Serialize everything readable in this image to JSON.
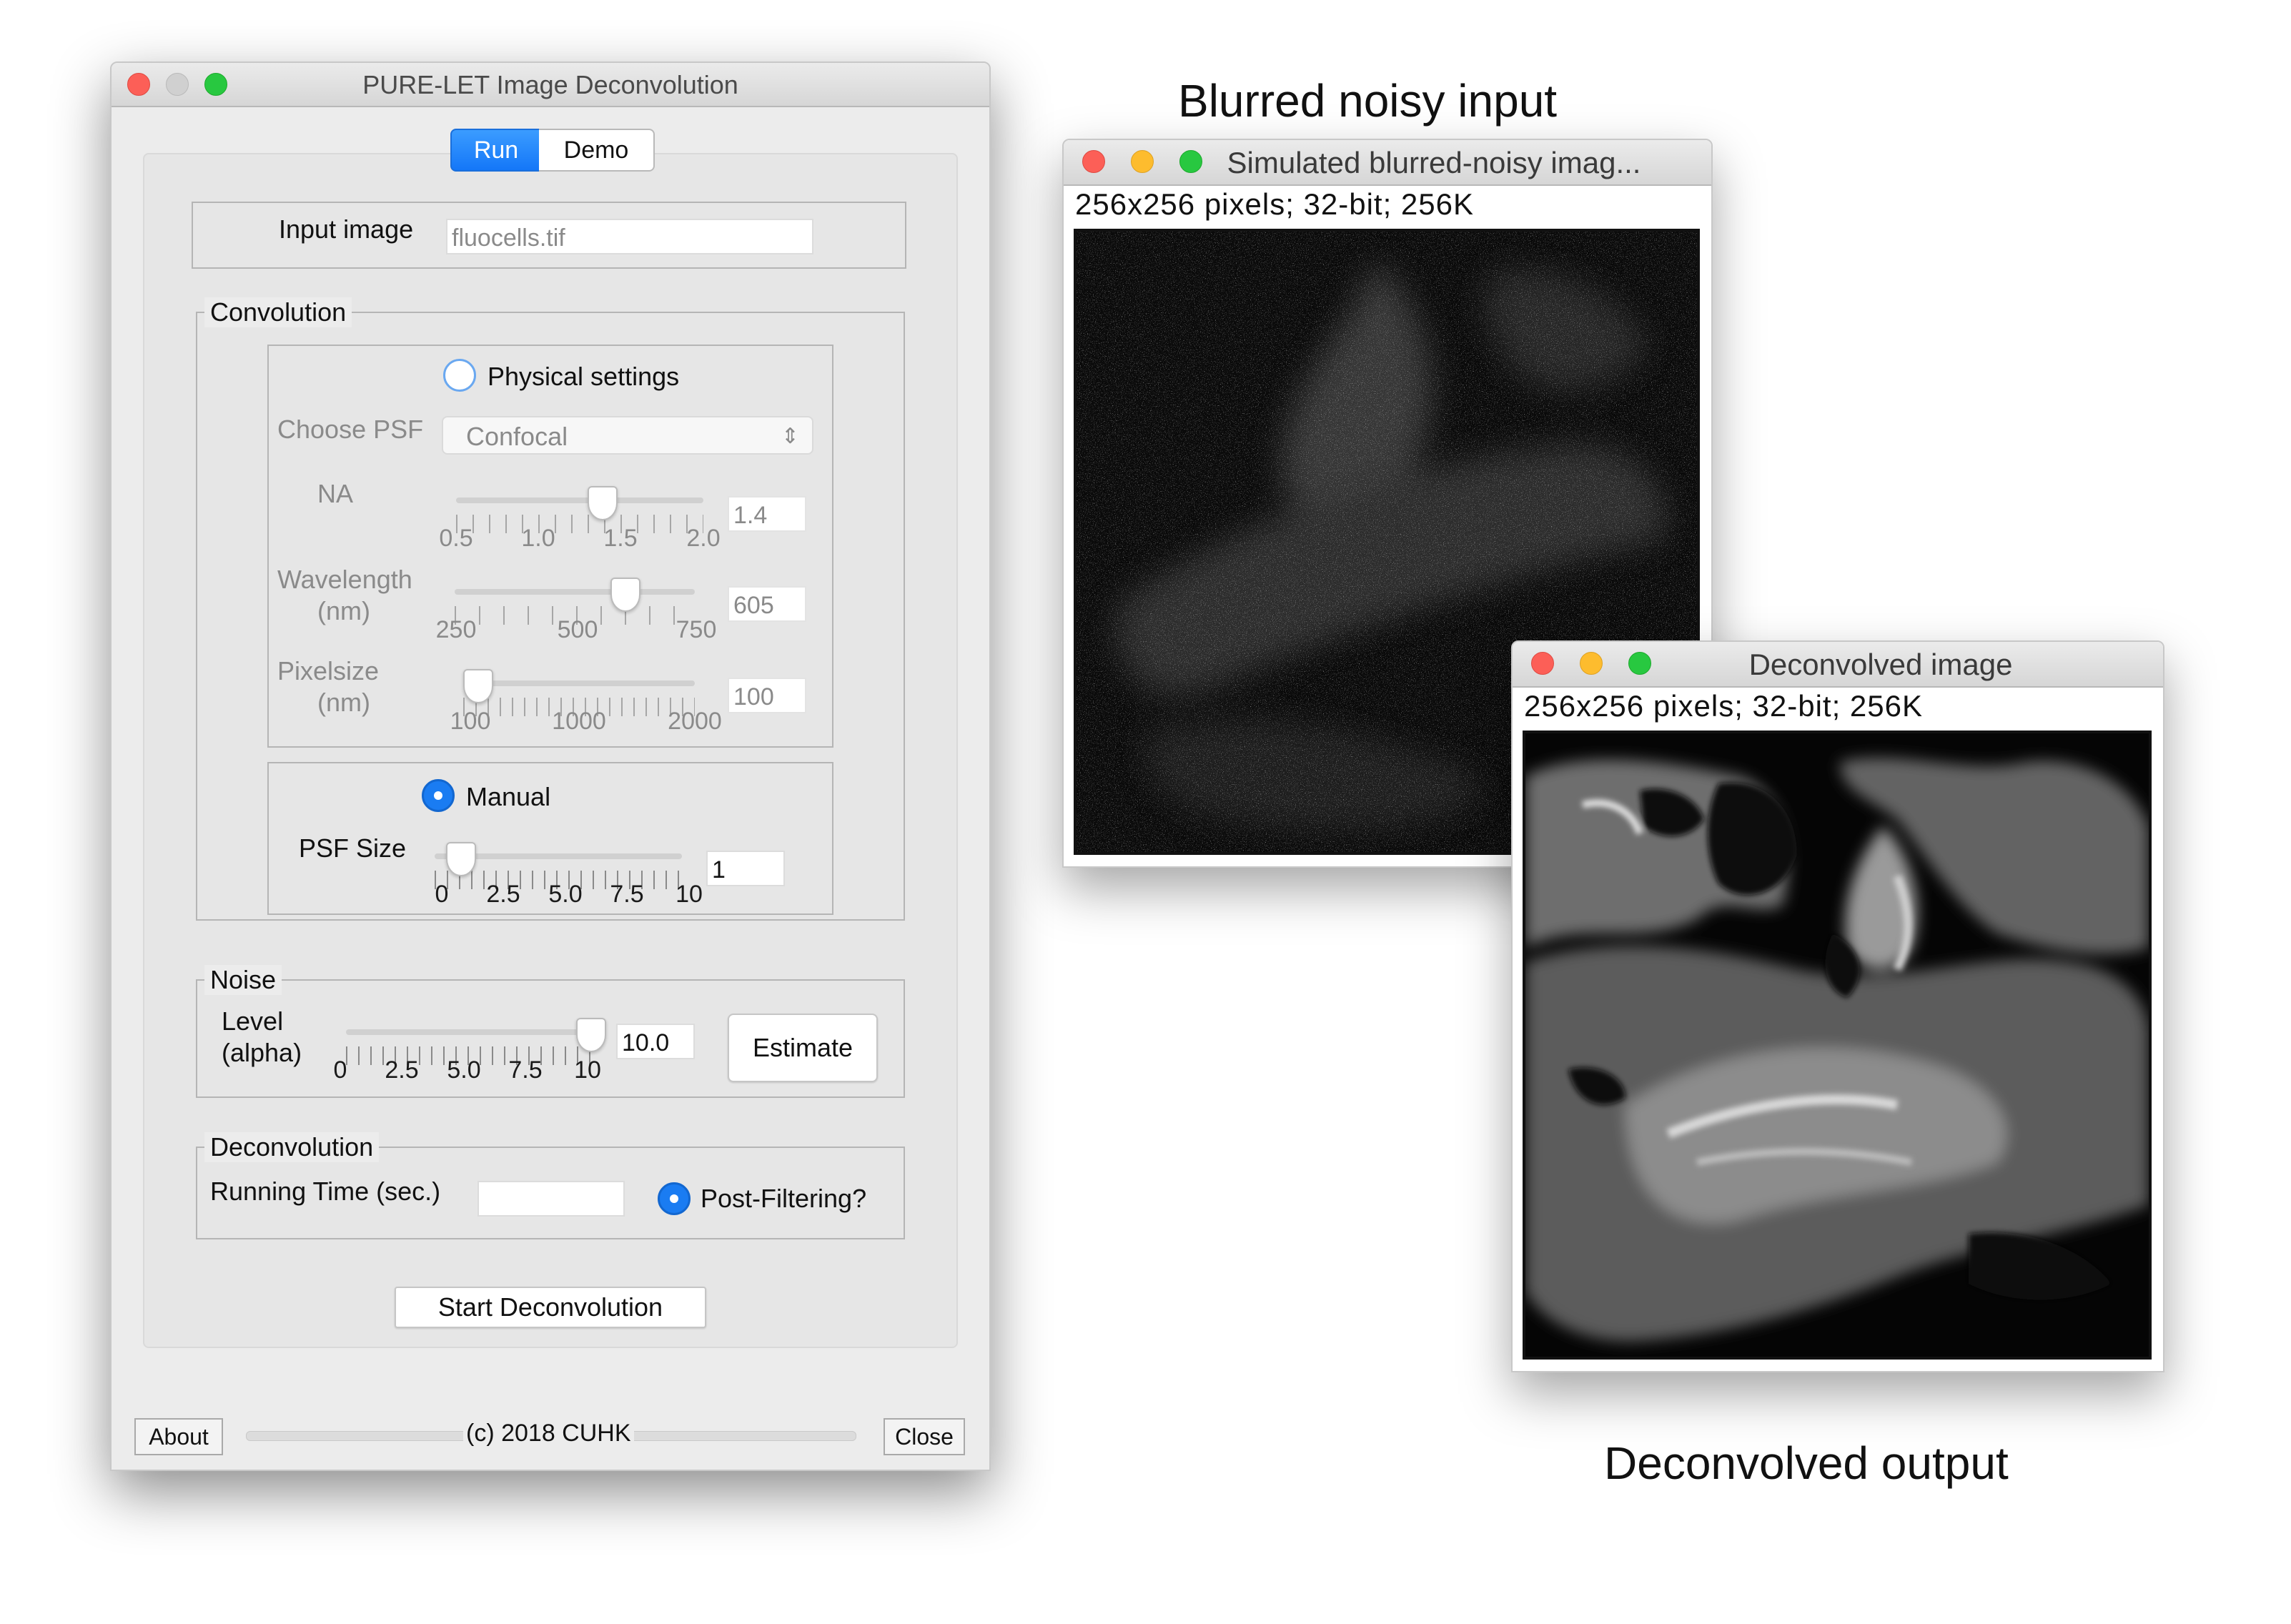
{
  "dialog": {
    "title": "PURE-LET Image Deconvolution",
    "tabs": {
      "run": "Run",
      "demo": "Demo"
    },
    "input": {
      "label": "Input image",
      "value": "fluocells.tif"
    },
    "convolution": {
      "legend": "Convolution",
      "physical_label": "Physical settings",
      "psf_label": "Choose PSF",
      "psf_value": "Confocal",
      "na": {
        "label": "NA",
        "value": "1.4",
        "ticks": [
          "0.5",
          "1.0",
          "1.5",
          "2.0"
        ],
        "position": 0.6
      },
      "wavelength": {
        "label1": "Wavelength",
        "label2": "(nm)",
        "value": "605",
        "ticks": [
          "250",
          "500",
          "750"
        ],
        "position": 0.71
      },
      "pixelsize": {
        "label1": "Pixelsize",
        "label2": "(nm)",
        "value": "100",
        "ticks": [
          "100",
          "1000",
          "2000"
        ],
        "position": 0.0
      },
      "manual_label": "Manual",
      "psf_size": {
        "label": "PSF Size",
        "value": "1",
        "ticks": [
          "0",
          "2.5",
          "5.0",
          "7.5",
          "10"
        ],
        "position": 0.1
      }
    },
    "noise": {
      "legend": "Noise",
      "level_label1": "Level",
      "level_label2": "(alpha)",
      "value": "10.0",
      "ticks": [
        "0",
        "2.5",
        "5.0",
        "7.5",
        "10"
      ],
      "position": 1.0,
      "estimate_label": "Estimate"
    },
    "deconvolution": {
      "legend": "Deconvolution",
      "running_time_label": "Running Time (sec.)",
      "running_time_value": "",
      "postfilter_label": "Post-Filtering?"
    },
    "start_label": "Start Deconvolution",
    "about_label": "About",
    "copyright": "(c) 2018 CUHK",
    "close_label": "Close"
  },
  "input_window": {
    "caption": "Blurred noisy input",
    "title": "Simulated blurred-noisy imag...",
    "info": "256x256 pixels; 32-bit; 256K"
  },
  "output_window": {
    "caption": "Deconvolved output",
    "title": "Deconvolved image",
    "info": "256x256 pixels; 32-bit; 256K"
  },
  "colors": {
    "accent": "#1a7cf2",
    "close": "#fc5f57",
    "minimize": "#fdbc2e",
    "zoom": "#28c840"
  }
}
